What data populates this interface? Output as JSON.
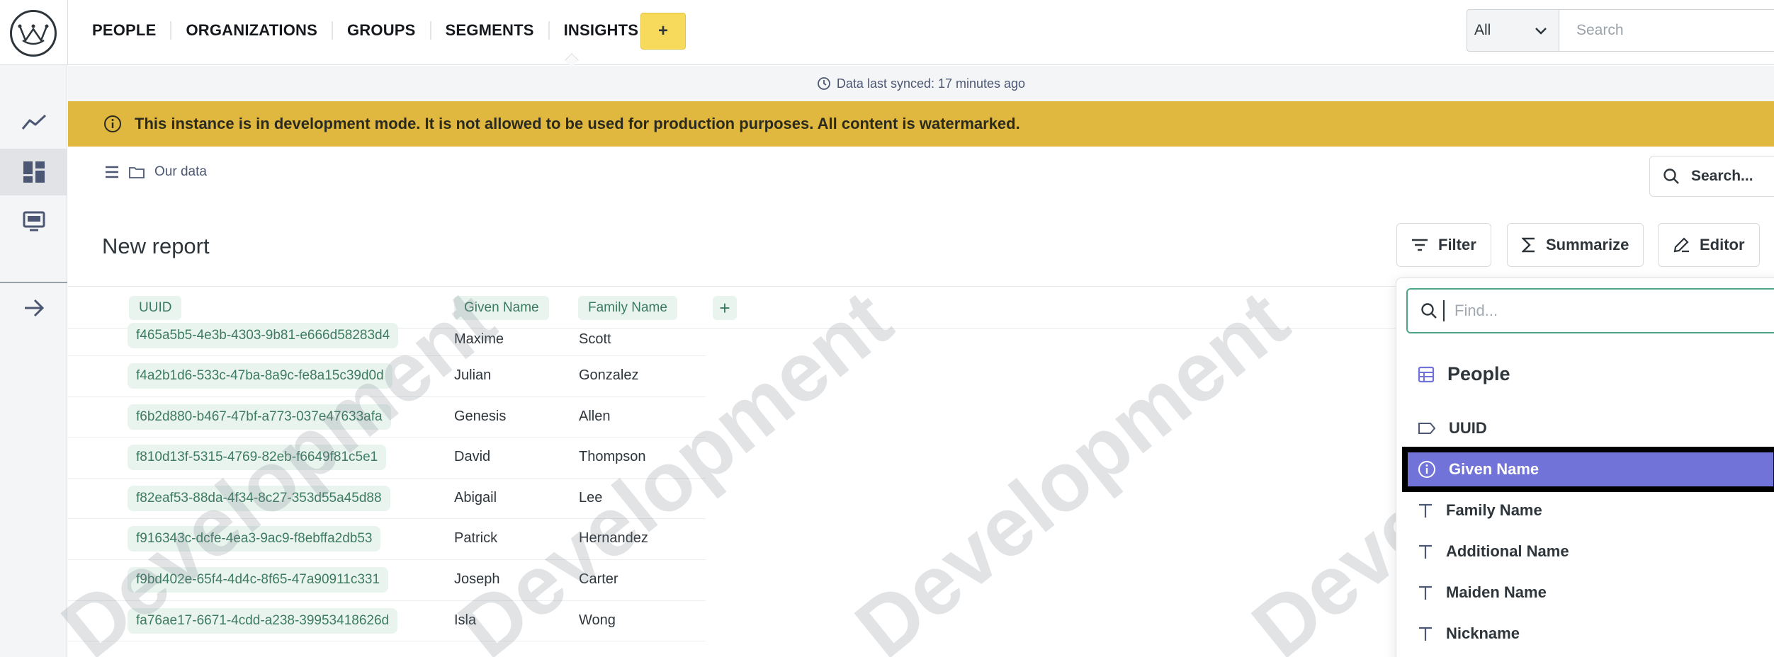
{
  "nav": {
    "items": [
      "PEOPLE",
      "ORGANIZATIONS",
      "GROUPS",
      "SEGMENTS",
      "INSIGHTS"
    ],
    "add_label": "+"
  },
  "search": {
    "scope": "All",
    "placeholder": "Search"
  },
  "sync": {
    "text": "Data last synced: 17 minutes ago"
  },
  "banner": {
    "text": "This instance is in development mode. It is not allowed to be used for production purposes. All content is watermarked."
  },
  "breadcrumb": {
    "label": "Our data"
  },
  "header_search": {
    "label": "Search..."
  },
  "report": {
    "title": "New report",
    "filter_label": "Filter",
    "summarize_label": "Summarize",
    "editor_label": "Editor"
  },
  "table": {
    "columns": [
      "UUID",
      "Given Name",
      "Family Name"
    ],
    "add_column": "+",
    "rows": [
      {
        "uuid": "f465a5b5-4e3b-4303-9b81-e666d58283d4",
        "given": "Maxime",
        "family": "Scott"
      },
      {
        "uuid": "f4a2b1d6-533c-47ba-8a9c-fe8a15c39d0d",
        "given": "Julian",
        "family": "Gonzalez"
      },
      {
        "uuid": "f6b2d880-b467-47bf-a773-037e47633afa",
        "given": "Genesis",
        "family": "Allen"
      },
      {
        "uuid": "f810d13f-5315-4769-82eb-f6649f81c5e1",
        "given": "David",
        "family": "Thompson"
      },
      {
        "uuid": "f82eaf53-88da-4f34-8c27-353d55a45d88",
        "given": "Abigail",
        "family": "Lee"
      },
      {
        "uuid": "f916343c-dcfe-4ea3-9ac9-f8ebffa2db53",
        "given": "Patrick",
        "family": "Hernandez"
      },
      {
        "uuid": "f9bd402e-65f4-4d4c-8f65-47a90911c331",
        "given": "Joseph",
        "family": "Carter"
      },
      {
        "uuid": "fa76ae17-6671-4cdd-a238-39953418626d",
        "given": "Isla",
        "family": "Wong"
      }
    ]
  },
  "watermark": "Development",
  "dropdown": {
    "placeholder": "Find...",
    "table_name": "People",
    "options": [
      {
        "label": "UUID",
        "icon": "tag-icon"
      },
      {
        "label": "Given Name",
        "icon": "info-icon",
        "selected": true
      },
      {
        "label": "Family Name",
        "icon": "text-icon"
      },
      {
        "label": "Additional Name",
        "icon": "text-icon"
      },
      {
        "label": "Maiden Name",
        "icon": "text-icon"
      },
      {
        "label": "Nickname",
        "icon": "text-icon"
      }
    ]
  },
  "colors": {
    "accent_yellow": "#f7da5c",
    "banner": "#e0b83f",
    "selection": "#7173d9",
    "pill_green": "#397a61"
  }
}
